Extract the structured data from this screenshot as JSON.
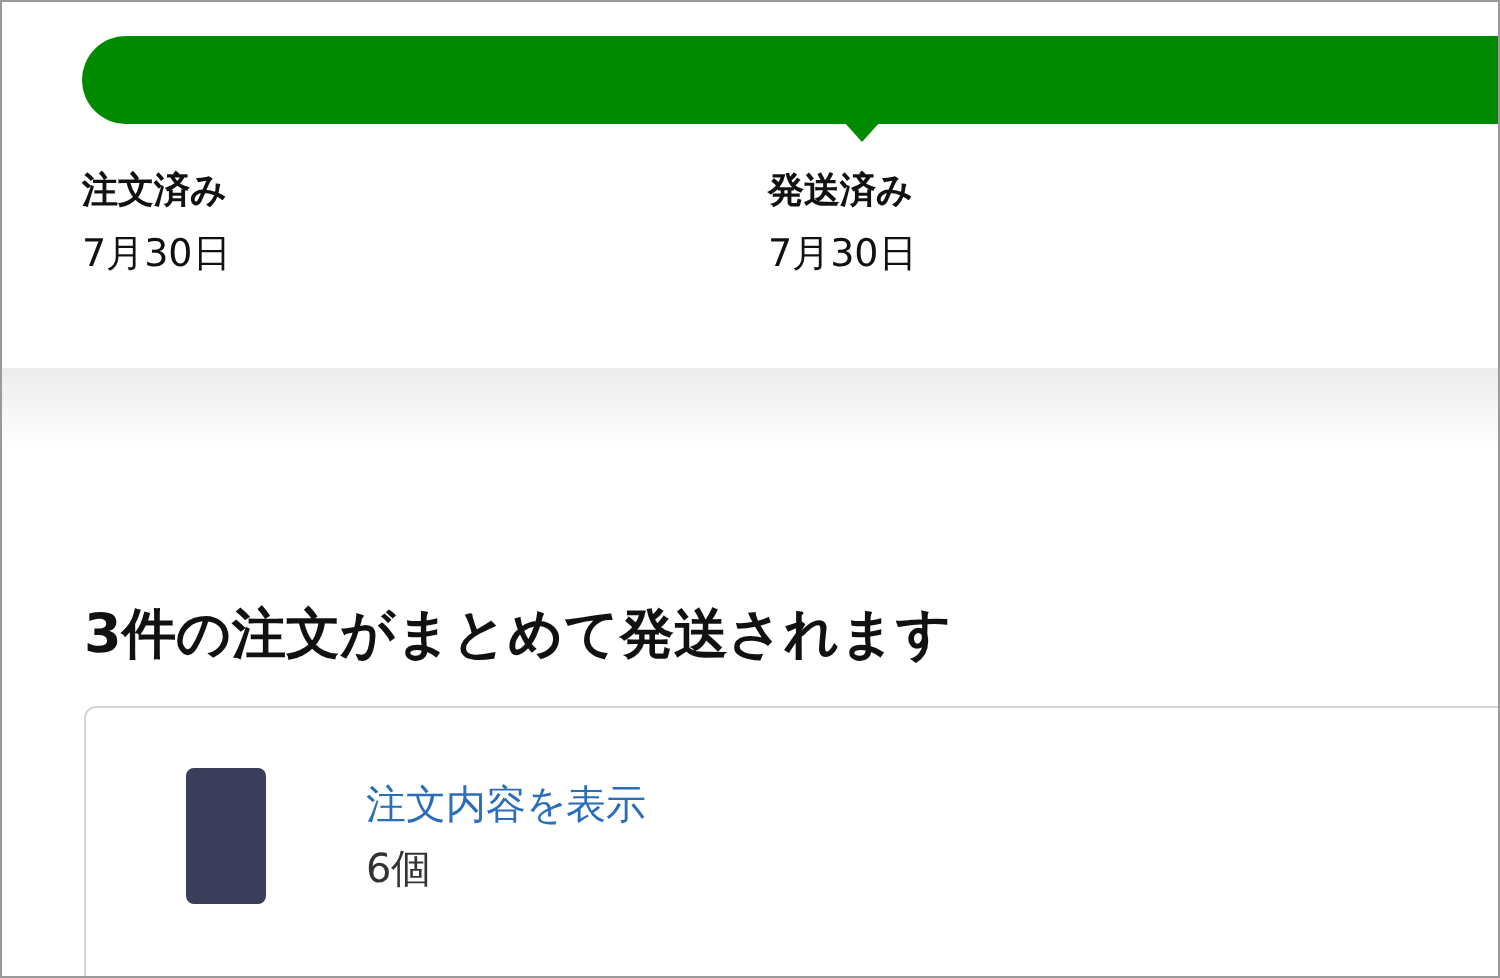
{
  "tracker": {
    "level": 1,
    "steps": [
      {
        "label": "注文済み",
        "date": "7月30日",
        "selected": false
      },
      {
        "label": "発送済み",
        "date": "7月30日",
        "selected": true
      }
    ]
  },
  "shipment": {
    "heading": "3件の注文がまとめて発送されます",
    "item": {
      "link": "注文内容を表示",
      "quantity": "6個"
    }
  }
}
